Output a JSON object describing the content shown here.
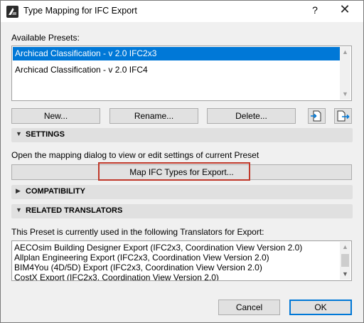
{
  "window": {
    "title": "Type Mapping for IFC Export",
    "help_label": "?",
    "close_label": "✕"
  },
  "presets": {
    "label": "Available Presets:",
    "items": [
      {
        "label": "Archicad Classification - v 2.0 IFC2x3",
        "selected": true
      },
      {
        "label": "Archicad Classification - v 2.0 IFC4",
        "selected": false
      }
    ],
    "buttons": {
      "new": "New...",
      "rename": "Rename...",
      "delete": "Delete..."
    }
  },
  "settings": {
    "title": "SETTINGS",
    "description": "Open the mapping dialog to view or edit settings of current Preset",
    "map_button": "Map IFC Types for Export..."
  },
  "compatibility": {
    "title": "COMPATIBILITY"
  },
  "translators": {
    "title": "RELATED TRANSLATORS",
    "description": "This Preset is currently used in the following Translators for Export:",
    "items": [
      "AECOsim Building Designer Export (IFC2x3, Coordination View Version 2.0)",
      "Allplan Engineering Export (IFC2x3, Coordination View Version 2.0)",
      "BIM4You (4D/5D) Export (IFC2x3, Coordination View Version 2.0)",
      "CostX Export (IFC2x3, Coordination View Version 2.0)"
    ]
  },
  "footer": {
    "cancel": "Cancel",
    "ok": "OK"
  },
  "colors": {
    "selection": "#0078d7",
    "highlight_border": "#c0392b",
    "ok_border": "#0078d7"
  }
}
